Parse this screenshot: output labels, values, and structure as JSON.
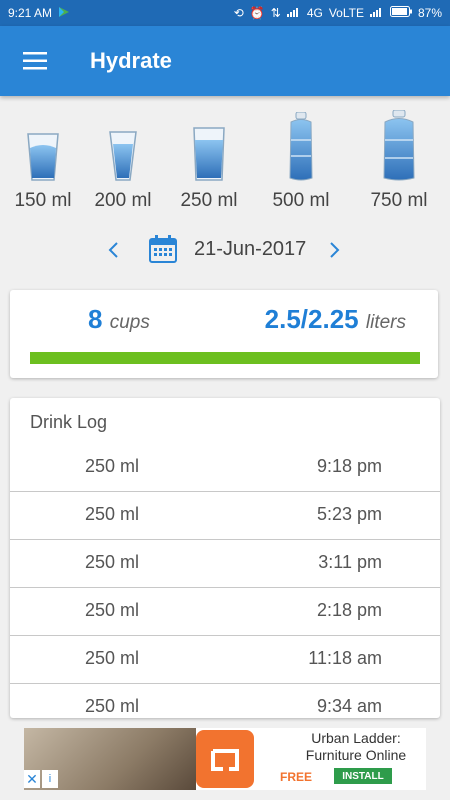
{
  "status_bar": {
    "time": "9:21 AM",
    "network": "4G",
    "volte": "VoLTE",
    "battery": "87%"
  },
  "app_bar": {
    "title": "Hydrate"
  },
  "presets": [
    {
      "label": "150 ml",
      "icon": "short-glass-icon"
    },
    {
      "label": "200 ml",
      "icon": "tall-glass-icon"
    },
    {
      "label": "250 ml",
      "icon": "mug-glass-icon"
    },
    {
      "label": "500 ml",
      "icon": "bottle-icon"
    },
    {
      "label": "750 ml",
      "icon": "large-bottle-icon"
    }
  ],
  "date_nav": {
    "date": "21-Jun-2017"
  },
  "summary": {
    "cups": "8",
    "cups_unit": "cups",
    "consumed": "2.5",
    "separator": "/",
    "goal": "2.25",
    "liters_unit": "liters",
    "progress": 1.0,
    "progress_color": "#6cbf1f"
  },
  "log": {
    "title": "Drink Log",
    "entries": [
      {
        "amount": "250 ml",
        "time": "9:18 pm"
      },
      {
        "amount": "250 ml",
        "time": "5:23 pm"
      },
      {
        "amount": "250 ml",
        "time": "3:11 pm"
      },
      {
        "amount": "250 ml",
        "time": "2:18 pm"
      },
      {
        "amount": "250 ml",
        "time": "11:18 am"
      },
      {
        "amount": "250 ml",
        "time": "9:34 am"
      }
    ]
  },
  "ad": {
    "title_line1": "Urban Ladder:",
    "title_line2": "Furniture Online",
    "free": "FREE",
    "install": "INSTALL",
    "close": "✕",
    "info": "i"
  },
  "colors": {
    "primary": "#2a85d6",
    "status_bar": "#1f6ab5",
    "accent": "#1f7fd6"
  }
}
